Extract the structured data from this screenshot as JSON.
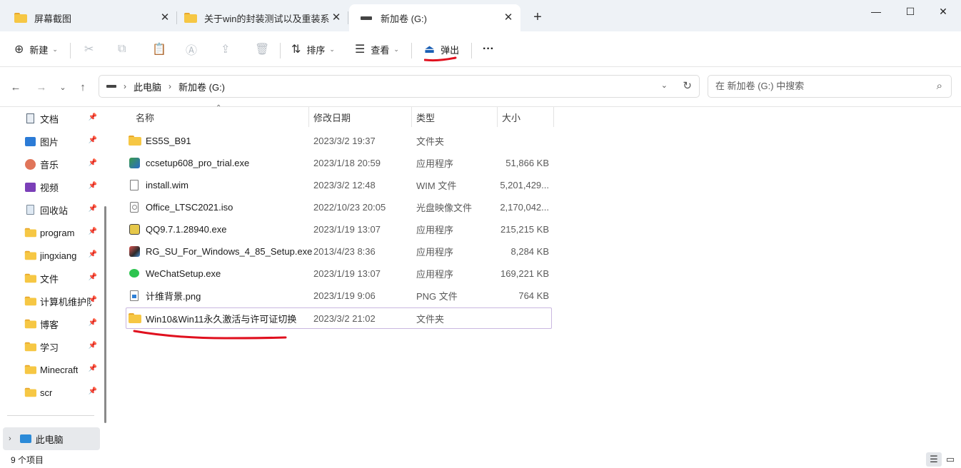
{
  "tabs": [
    {
      "label": "屏幕截图",
      "icon": "folder-icon"
    },
    {
      "label": "关于win的封装测试以及重装系",
      "icon": "folder-icon"
    },
    {
      "label": "新加卷 (G:)",
      "icon": "drive-icon",
      "active": true
    }
  ],
  "window": {
    "minimize": "—",
    "maximize": "☐",
    "close": "✕",
    "new_tab": "+"
  },
  "toolbar": {
    "new_label": "新建",
    "sort_label": "排序",
    "view_label": "查看",
    "eject_label": "弹出",
    "more_label": "···"
  },
  "address": {
    "crumb_root": "此电脑",
    "crumb_drive": "新加卷 (G:)"
  },
  "search": {
    "placeholder": "在 新加卷 (G:) 中搜索"
  },
  "sidebar": {
    "items": [
      {
        "label": "文档",
        "icon": "document-icon"
      },
      {
        "label": "图片",
        "icon": "pictures-icon"
      },
      {
        "label": "音乐",
        "icon": "music-icon"
      },
      {
        "label": "视频",
        "icon": "video-icon"
      },
      {
        "label": "回收站",
        "icon": "recycle-bin-icon"
      },
      {
        "label": "program",
        "icon": "folder-icon"
      },
      {
        "label": "jingxiang",
        "icon": "folder-icon"
      },
      {
        "label": "文件",
        "icon": "folder-icon"
      },
      {
        "label": "计算机维护队",
        "icon": "folder-icon"
      },
      {
        "label": "博客",
        "icon": "folder-icon"
      },
      {
        "label": "学习",
        "icon": "folder-icon"
      },
      {
        "label": "Minecraft",
        "icon": "folder-icon"
      },
      {
        "label": "scr",
        "icon": "folder-icon"
      }
    ],
    "this_pc": "此电脑"
  },
  "columns": {
    "name": "名称",
    "date": "修改日期",
    "type": "类型",
    "size": "大小"
  },
  "files": [
    {
      "name": "ES5S_B91",
      "date": "2023/3/2 19:37",
      "type": "文件夹",
      "size": "",
      "icon": "folder-icon"
    },
    {
      "name": "ccsetup608_pro_trial.exe",
      "date": "2023/1/18 20:59",
      "type": "应用程序",
      "size": "51,866 KB",
      "icon": "ccleaner-icon"
    },
    {
      "name": "install.wim",
      "date": "2023/3/2 12:48",
      "type": "WIM 文件",
      "size": "5,201,429...",
      "icon": "file-icon"
    },
    {
      "name": "Office_LTSC2021.iso",
      "date": "2022/10/23 20:05",
      "type": "光盘映像文件",
      "size": "2,170,042...",
      "icon": "disc-image-icon"
    },
    {
      "name": "QQ9.7.1.28940.exe",
      "date": "2023/1/19 13:07",
      "type": "应用程序",
      "size": "215,215 KB",
      "icon": "qq-icon"
    },
    {
      "name": "RG_SU_For_Windows_4_85_Setup.exe",
      "date": "2013/4/23 8:36",
      "type": "应用程序",
      "size": "8,284 KB",
      "icon": "installer-icon"
    },
    {
      "name": "WeChatSetup.exe",
      "date": "2023/1/19 13:07",
      "type": "应用程序",
      "size": "169,221 KB",
      "icon": "wechat-icon"
    },
    {
      "name": "计维背景.png",
      "date": "2023/1/19 9:06",
      "type": "PNG 文件",
      "size": "764 KB",
      "icon": "image-file-icon"
    },
    {
      "name": "Win10&Win11永久激活与许可证切换",
      "date": "2023/3/2 21:02",
      "type": "文件夹",
      "size": "",
      "icon": "folder-icon",
      "selected": true
    }
  ],
  "status": {
    "count": "9 个项目"
  },
  "colors": {
    "accent_red": "#e0101e",
    "folder": "#f6c744",
    "selected_border": "#c9b7e0"
  }
}
